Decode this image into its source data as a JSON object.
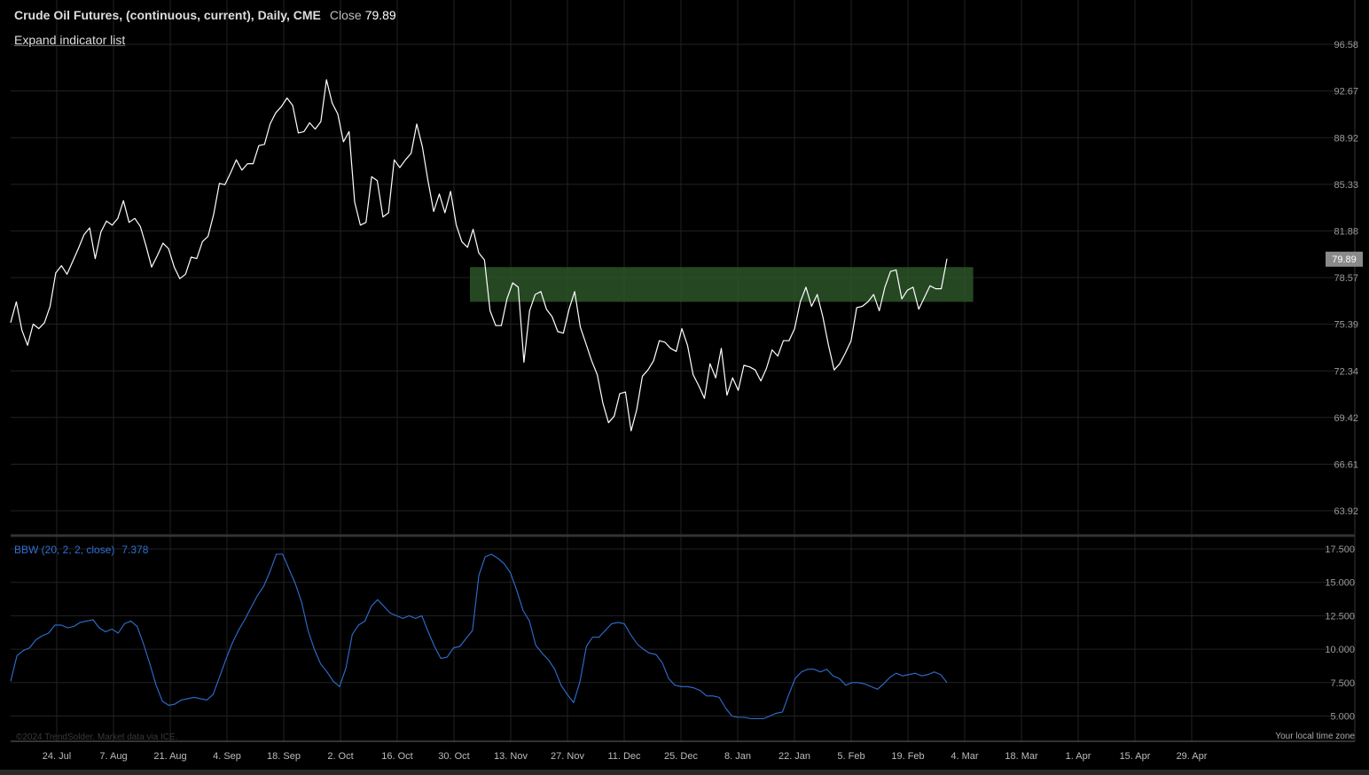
{
  "header": {
    "title": "Crude Oil Futures, (continuous, current), Daily, CME",
    "close_label": "Close",
    "close_value": "79.89"
  },
  "expand_label": "Expand indicator list",
  "indicator": {
    "label": "BBW (20, 2, 2, close)",
    "value": "7.378"
  },
  "copyright": "©2024 TrendSolder. Market data via ICE.",
  "timezone_label": "Your local time zone",
  "colors": {
    "background": "#000000",
    "price_line": "#ffffff",
    "indicator_line": "#2f6fd3",
    "zone": "#2e5a2c",
    "grid": "#222222",
    "last_price_badge": "#8a8a8a"
  },
  "chart_data": [
    {
      "type": "line",
      "series": [
        {
          "values": [
            75.5,
            76.9,
            75.0,
            74.0,
            75.4,
            75.1,
            75.5,
            76.6,
            78.9,
            79.4,
            78.8,
            79.7,
            80.6,
            81.6,
            82.1,
            79.9,
            81.8,
            82.6,
            82.3,
            82.8,
            84.1,
            82.5,
            82.8,
            82.2,
            80.8,
            79.3,
            80.1,
            81.0,
            80.6,
            79.3,
            78.5,
            78.8,
            80.0,
            79.9,
            81.1,
            81.5,
            83.1,
            85.4,
            85.3,
            86.2,
            87.2,
            86.4,
            86.9,
            86.9,
            88.3,
            88.4,
            90.0,
            90.9,
            91.4,
            92.1,
            91.5,
            89.3,
            89.4,
            90.1,
            89.6,
            90.2,
            93.6,
            91.7,
            90.8,
            88.6,
            89.4,
            84.0,
            82.3,
            82.5,
            85.9,
            85.6,
            82.9,
            83.2,
            87.2,
            86.6,
            87.2,
            87.7,
            90.0,
            88.2,
            85.6,
            83.3,
            84.6,
            83.2,
            84.8,
            82.3,
            81.1,
            80.7,
            82.0,
            80.3,
            79.8,
            76.3,
            75.3,
            75.3,
            77.1,
            78.2,
            77.9,
            72.9,
            76.3,
            77.4,
            77.6,
            76.4,
            75.9,
            74.9,
            74.8,
            76.4,
            77.6,
            75.2,
            74.1,
            73.0,
            72.1,
            70.3,
            69.1,
            69.5,
            70.9,
            71.0,
            68.6,
            69.9,
            72.0,
            72.4,
            73.0,
            74.3,
            74.2,
            73.8,
            73.6,
            75.1,
            74.0,
            72.1,
            71.4,
            70.6,
            72.8,
            71.9,
            73.8,
            70.8,
            71.9,
            71.1,
            72.7,
            72.6,
            72.4,
            71.7,
            72.5,
            73.7,
            73.3,
            74.3,
            74.3,
            75.1,
            76.9,
            77.9,
            76.6,
            77.4,
            75.9,
            74.0,
            72.4,
            72.8,
            73.5,
            74.3,
            76.5,
            76.6,
            76.9,
            77.4,
            76.3,
            77.9,
            79.0,
            79.1,
            77.1,
            77.7,
            77.9,
            76.4,
            77.2,
            78.0,
            77.8,
            77.8,
            79.89
          ]
        }
      ],
      "y_ticks": [
        "96.58",
        "92.67",
        "88.92",
        "85.33",
        "81.88",
        "78.57",
        "75.39",
        "72.34",
        "69.42",
        "66.61",
        "63.92"
      ],
      "last_price_label": "79.89",
      "zone": {
        "y_low": 76.9,
        "y_high": 79.3,
        "from_x": "6. Nov",
        "to_x": "8. Mar"
      },
      "grid": true
    },
    {
      "type": "line",
      "series": [
        {
          "name": "BBW (20, 2, 2, close)",
          "values": [
            7.6,
            9.5,
            9.9,
            10.1,
            10.7,
            11.0,
            11.2,
            11.8,
            11.8,
            11.6,
            11.7,
            12.0,
            12.1,
            12.2,
            11.6,
            11.3,
            11.5,
            11.2,
            11.9,
            12.1,
            11.7,
            10.4,
            8.9,
            7.3,
            6.1,
            5.8,
            5.9,
            6.2,
            6.3,
            6.4,
            6.3,
            6.2,
            6.6,
            7.9,
            9.2,
            10.4,
            11.4,
            12.2,
            13.1,
            14.0,
            14.7,
            15.8,
            17.1,
            17.1,
            16.0,
            14.9,
            13.5,
            11.4,
            10.0,
            8.9,
            8.3,
            7.6,
            7.2,
            8.6,
            11.1,
            11.8,
            12.1,
            13.2,
            13.7,
            13.2,
            12.7,
            12.5,
            12.3,
            12.5,
            12.3,
            12.5,
            11.3,
            10.2,
            9.3,
            9.4,
            10.1,
            10.2,
            10.8,
            11.4,
            15.5,
            16.9,
            17.1,
            16.8,
            16.4,
            15.7,
            14.4,
            12.9,
            12.1,
            10.3,
            9.7,
            9.2,
            8.5,
            7.3,
            6.6,
            6.0,
            7.6,
            10.2,
            10.9,
            10.9,
            11.4,
            11.9,
            12.0,
            11.9,
            11.1,
            10.4,
            10.0,
            9.7,
            9.6,
            9.0,
            7.8,
            7.3,
            7.2,
            7.2,
            7.1,
            6.9,
            6.5,
            6.5,
            6.4,
            5.6,
            5.0,
            4.9,
            4.9,
            4.8,
            4.8,
            4.8,
            5.0,
            5.2,
            5.3,
            6.6,
            7.8,
            8.3,
            8.5,
            8.5,
            8.3,
            8.5,
            8.0,
            7.8,
            7.3,
            7.5,
            7.5,
            7.4,
            7.2,
            7.0,
            7.4,
            7.9,
            8.2,
            8.0,
            8.1,
            8.2,
            8.0,
            8.1,
            8.3,
            8.1,
            7.5
          ]
        }
      ],
      "ylim": [
        4.5,
        17.5
      ],
      "y_ticks": [
        "17.500",
        "15.000",
        "12.500",
        "10.000",
        "7.500",
        "5.000"
      ],
      "x_ticks": [
        "24. Jul",
        "7. Aug",
        "21. Aug",
        "4. Sep",
        "18. Sep",
        "2. Oct",
        "16. Oct",
        "30. Oct",
        "13. Nov",
        "27. Nov",
        "11. Dec",
        "25. Dec",
        "8. Jan",
        "22. Jan",
        "5. Feb",
        "19. Feb",
        "4. Mar",
        "18. Mar",
        "1. Apr",
        "15. Apr",
        "29. Apr"
      ],
      "grid": true
    }
  ]
}
